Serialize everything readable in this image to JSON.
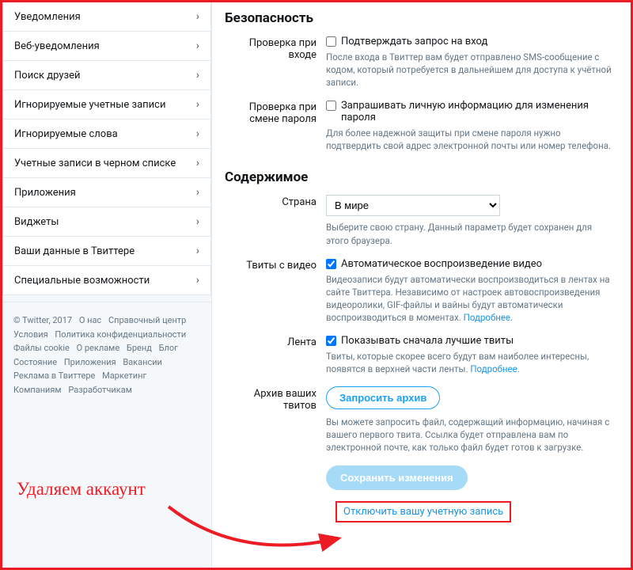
{
  "sidebar": {
    "items": [
      {
        "label": "Уведомления"
      },
      {
        "label": "Веб-уведомления"
      },
      {
        "label": "Поиск друзей"
      },
      {
        "label": "Игнорируемые учетные записи"
      },
      {
        "label": "Игнорируемые слова"
      },
      {
        "label": "Учетные записи в черном списке"
      },
      {
        "label": "Приложения"
      },
      {
        "label": "Виджеты"
      },
      {
        "label": "Ваши данные в Твиттере"
      },
      {
        "label": "Специальные возможности"
      }
    ]
  },
  "footer": {
    "copyright": "© Twitter, 2017",
    "links": [
      "О нас",
      "Справочный центр",
      "Условия",
      "Политика конфиденциальности",
      "Файлы cookie",
      "О рекламе",
      "Бренд",
      "Блог",
      "Состояние",
      "Приложения",
      "Вакансии",
      "Реклама в Твиттере",
      "Маркетинг",
      "Компаниям",
      "Разработчикам"
    ]
  },
  "security": {
    "heading": "Безопасность",
    "login_verify": {
      "label": "Проверка при входе",
      "checkbox": "Подтверждать запрос на вход",
      "help": "После входа в Твиттер вам будет отправлено SMS-сообщение с кодом, который потребуется в дальнейшем для доступа к учётной записи."
    },
    "password_verify": {
      "label": "Проверка при смене пароля",
      "checkbox": "Запрашивать личную информацию для изменения пароля",
      "help": "Для более надежной защиты при смене пароля нужно подтвердить свой адрес электронной почты или номер телефона."
    }
  },
  "content": {
    "heading": "Содержимое",
    "country": {
      "label": "Страна",
      "value": "В мире",
      "help": "Выберите свою страну. Данный параметр будет сохранен для этого браузера."
    },
    "video": {
      "label": "Твиты с видео",
      "checkbox": "Автоматическое воспроизведение видео",
      "help": "Видеозаписи будут автоматически воспроизводиться в лентах на сайте Твиттера. Независимо от настроек автовоспроизведения видеоролики, GIF-файлы и вайны будут автоматически воспроизводиться в моментах. ",
      "more": "Подробнее."
    },
    "timeline": {
      "label": "Лента",
      "checkbox": "Показывать сначала лучшие твиты",
      "help": "Твиты, которые скорее всего будут вам наиболее интересны, появятся в верхней части ленты. ",
      "more": "Подробнее."
    },
    "archive": {
      "label": "Архив ваших твитов",
      "button": "Запросить архив",
      "help": "Вы можете запросить файл, содержащий информацию, начиная с вашего первого твита. Ссылка будет отправлена вам по электронной почте, как только файл будет готов к загрузке."
    },
    "save_button": "Сохранить изменения",
    "deactivate": "Отключить вашу учетную запись"
  },
  "annotation": "Удаляем аккаунт"
}
